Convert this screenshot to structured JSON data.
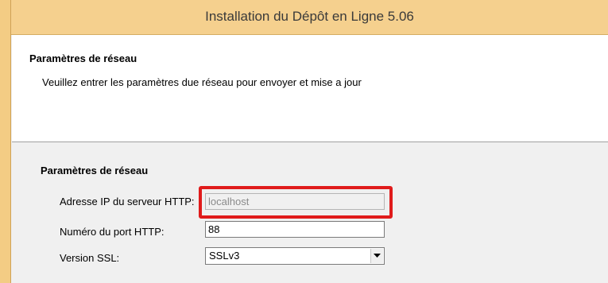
{
  "window": {
    "title": "Installation du Dépôt en Ligne 5.06"
  },
  "header": {
    "title": "Paramètres de réseau",
    "description": "Veuillez entrer les paramètres due réseau pour envoyer et mise a jour"
  },
  "form": {
    "section_title": "Paramètres de réseau",
    "server_ip_label": "Adresse IP du serveur HTTP:",
    "server_ip_value": "localhost",
    "port_label": "Numéro du port HTTP:",
    "port_value": "88",
    "ssl_label": "Version SSL:",
    "ssl_value": "SSLv3"
  },
  "colors": {
    "titlebar": "#f5d08e",
    "highlight": "#e01b1b"
  }
}
